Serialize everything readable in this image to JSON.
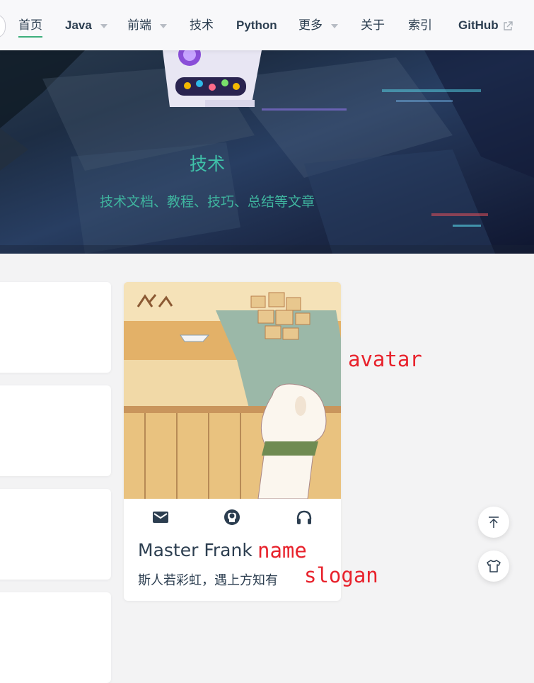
{
  "nav": {
    "items": [
      {
        "label": "首页",
        "active": true
      },
      {
        "label": "Java",
        "dropdown": true
      },
      {
        "label": "前端",
        "dropdown": true
      },
      {
        "label": "技术"
      },
      {
        "label": "Python"
      },
      {
        "label": "更多",
        "dropdown": true
      },
      {
        "label": "关于"
      },
      {
        "label": "索引"
      },
      {
        "label": "GitHub",
        "external": true
      }
    ]
  },
  "hero": {
    "title": "技术",
    "subtitle": "技术文档、教程、技巧、总结等文章"
  },
  "profile": {
    "name": "Master Frank",
    "slogan": "斯人若彩虹，遇上方知有",
    "social_icons": [
      "email-icon",
      "github-icon",
      "headphones-icon"
    ]
  },
  "annotations": {
    "avatar": "avatar",
    "name": "name",
    "slogan": "slogan"
  },
  "fabs": [
    "back-to-top-icon",
    "theme-shirt-icon"
  ],
  "colors": {
    "accent": "#3eaf7c",
    "hero_text": "#3fc1a9",
    "annotation": "#e8222c",
    "text": "#2c3e50"
  }
}
